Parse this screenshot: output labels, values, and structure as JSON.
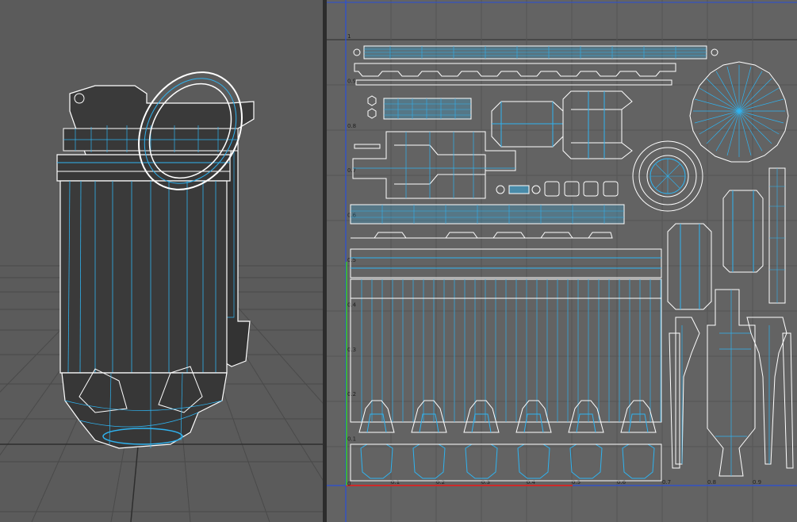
{
  "colors": {
    "viewport_bg": "#5b5b5b",
    "uv_bg": "#636363",
    "wire": "#ffffff",
    "uv_edge": "#2fb3f0",
    "mesh_fill": "#3a3a3a",
    "axis_u": "#cc2a2a",
    "axis_v": "#3fae3f",
    "axis_blue": "#2a4fd8"
  },
  "uv_editor": {
    "u_ticks": [
      "0.1",
      "0.2",
      "0.3",
      "0.4",
      "0.5",
      "0.6",
      "0.7",
      "0.8",
      "0.9"
    ],
    "v_ticks": [
      "1",
      "0.9",
      "0.8",
      "0.7",
      "0.6",
      "0.5",
      "0.4",
      "0.3",
      "0.2",
      "0.1",
      "0"
    ]
  },
  "icons": {
    "viewport": "grenade-wireframe-model",
    "uv_shells": "uv-layout-shells"
  }
}
